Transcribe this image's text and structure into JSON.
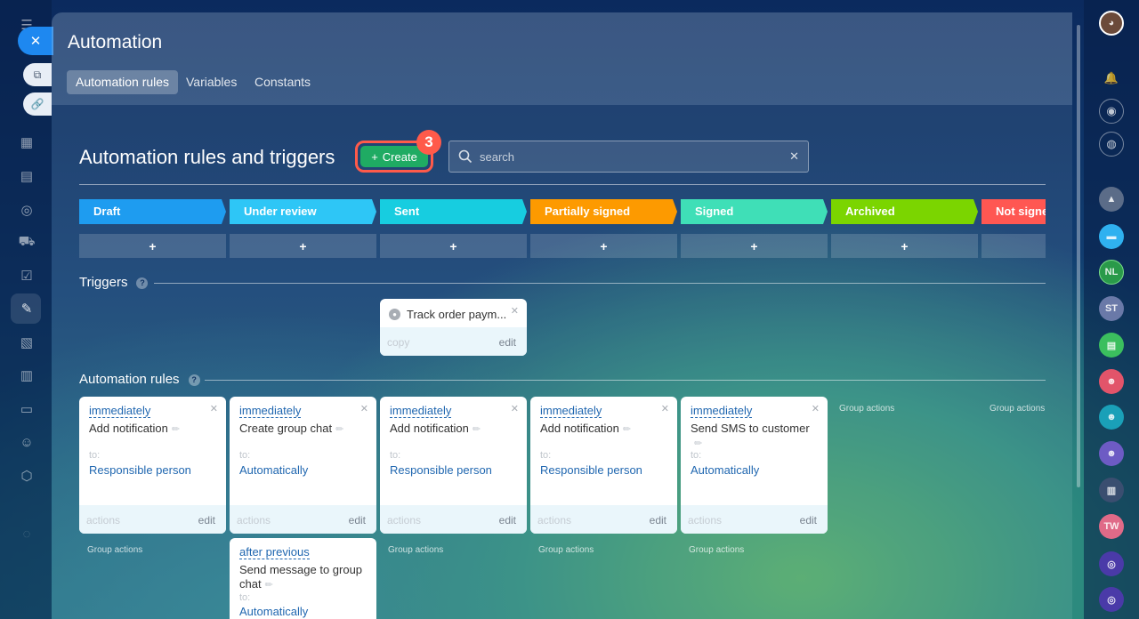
{
  "panel": {
    "title": "Automation",
    "tabs": [
      {
        "label": "Automation rules",
        "active": true
      },
      {
        "label": "Variables",
        "active": false
      },
      {
        "label": "Constants",
        "active": false
      }
    ]
  },
  "toolbar": {
    "section_title": "Automation rules and triggers",
    "create_label": "Create",
    "step_badge": "3",
    "search_placeholder": "search"
  },
  "stages": [
    {
      "label": "Draft",
      "color": "#1e9cf0"
    },
    {
      "label": "Under review",
      "color": "#2ec6f6"
    },
    {
      "label": "Sent",
      "color": "#17cde0"
    },
    {
      "label": "Partially signed",
      "color": "#fd9a00"
    },
    {
      "label": "Signed",
      "color": "#3fdfb7"
    },
    {
      "label": "Archived",
      "color": "#7bd500"
    },
    {
      "label": "Not signed",
      "color": "#ff5752"
    }
  ],
  "plus_symbol": "+",
  "triggers": {
    "label": "Triggers",
    "items": [
      {
        "name": "Track order paym...",
        "copy_label": "copy",
        "edit_label": "edit"
      }
    ]
  },
  "rules": {
    "label": "Automation rules",
    "cards": [
      {
        "when": "immediately",
        "name": "Add notification",
        "to_label": "to:",
        "recipient": "Responsible person",
        "actions_label": "actions",
        "edit_label": "edit"
      },
      {
        "when": "immediately",
        "name": "Create group chat",
        "to_label": "to:",
        "recipient": "Automatically",
        "actions_label": "actions",
        "edit_label": "edit"
      },
      {
        "when": "immediately",
        "name": "Add notification",
        "to_label": "to:",
        "recipient": "Responsible person",
        "actions_label": "actions",
        "edit_label": "edit"
      },
      {
        "when": "immediately",
        "name": "Add notification",
        "to_label": "to:",
        "recipient": "Responsible person",
        "actions_label": "actions",
        "edit_label": "edit"
      },
      {
        "when": "immediately",
        "name": "Send SMS to customer",
        "to_label": "to:",
        "recipient": "Automatically",
        "actions_label": "actions",
        "edit_label": "edit"
      }
    ],
    "second_card": {
      "when": "after previous",
      "name": "Send message to group chat",
      "to_label": "to:",
      "recipient": "Automatically"
    },
    "group_actions_label": "Group actions"
  },
  "right_avatars": [
    "NL",
    "ST",
    "TW"
  ]
}
